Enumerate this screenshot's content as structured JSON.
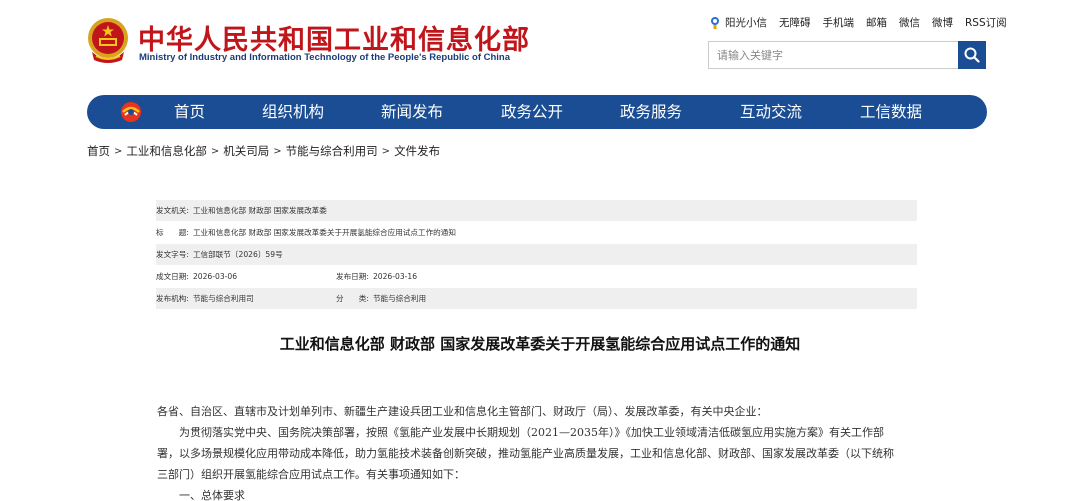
{
  "header": {
    "title": "中华人民共和国工业和信息化部",
    "subtitle": "Ministry of Industry and Information Technology of the People's Republic of China",
    "top_links": [
      "阳光小信",
      "无障碍",
      "手机端",
      "邮箱",
      "微信",
      "微博",
      "RSS订阅"
    ],
    "search_placeholder": "请输入关键字"
  },
  "nav": {
    "items": [
      "首页",
      "组织机构",
      "新闻发布",
      "政务公开",
      "政务服务",
      "互动交流",
      "工信数据"
    ]
  },
  "breadcrumb": [
    "首页",
    "工业和信息化部",
    "机关司局",
    "节能与综合利用司",
    "文件发布"
  ],
  "meta": {
    "issuer_label": "发文机关:",
    "issuer": "工业和信息化部 财政部 国家发展改革委",
    "title_label": "标　　题:",
    "title": "工业和信息化部 财政部 国家发展改革委关于开展氢能综合应用试点工作的通知",
    "doc_no_label": "发文字号:",
    "doc_no": "工信部联节〔2026〕59号",
    "created_label": "成文日期:",
    "created": "2026-03-06",
    "published_label": "发布日期:",
    "published": "2026-03-16",
    "org_label": "发布机构:",
    "org": "节能与综合利用司",
    "category_label": "分　　类:",
    "category": "节能与综合利用"
  },
  "article": {
    "title": "工业和信息化部 财政部 国家发展改革委关于开展氢能综合应用试点工作的通知",
    "salutation": "各省、自治区、直辖市及计划单列市、新疆生产建设兵团工业和信息化主管部门、财政厅（局）、发展改革委，有关中央企业：",
    "p1_line1": "为贯彻落实党中央、国务院决策部署，按照《氢能产业发展中长期规划（2021—2035年）》《加快工业领域清洁低碳氢应用实施方案》有关工作部",
    "p1_line2": "署，以多场景规模化应用带动成本降低，助力氢能技术装备创新突破，推动氢能产业高质量发展，工业和信息化部、财政部、国家发展改革委（以下统称",
    "p1_line3": "三部门）组织开展氢能综合应用试点工作。有关事项通知如下：",
    "h1": "一、总体要求"
  },
  "colors": {
    "brand_red": "#c0161b",
    "nav_blue": "#1a4d93",
    "meta_gray": "#efefef"
  }
}
